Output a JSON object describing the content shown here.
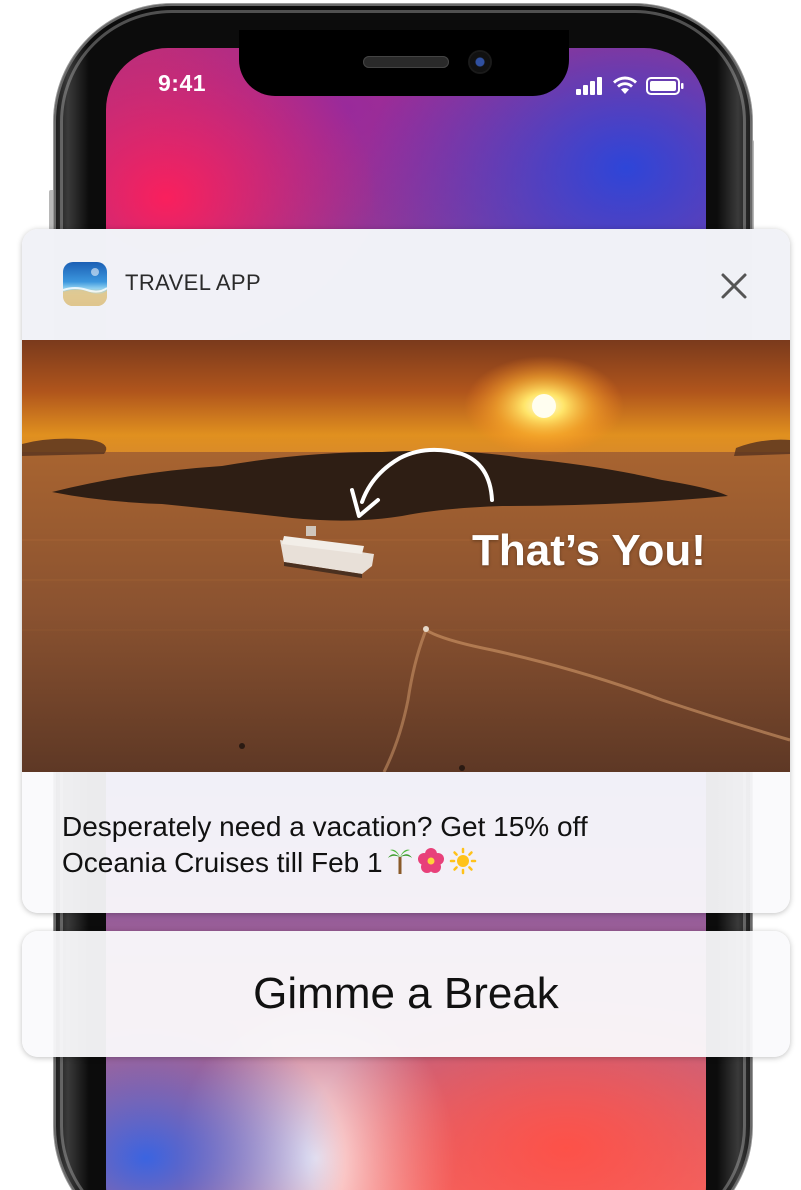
{
  "status_bar": {
    "time": "9:41",
    "signal_icon": "cellular-signal-icon",
    "wifi_icon": "wifi-icon",
    "battery_icon": "battery-icon"
  },
  "notification": {
    "app_name": "TRAVEL APP",
    "app_icon": "beach-app-icon",
    "close_icon": "close-icon",
    "hero_caption": "That’s You!",
    "hero_image": "sunset-cruise-photo",
    "body_line1": "Desperately need a vacation? Get 15% off",
    "body_line2": "Oceania Cruises till Feb 1",
    "emojis": [
      "🌴",
      "🌺",
      "☀️"
    ]
  },
  "actions": {
    "primary_label": "Gimme a Break"
  },
  "colors": {
    "card_background": "#fafafc",
    "text": "#111111",
    "header_background": "#f0f1f6"
  }
}
